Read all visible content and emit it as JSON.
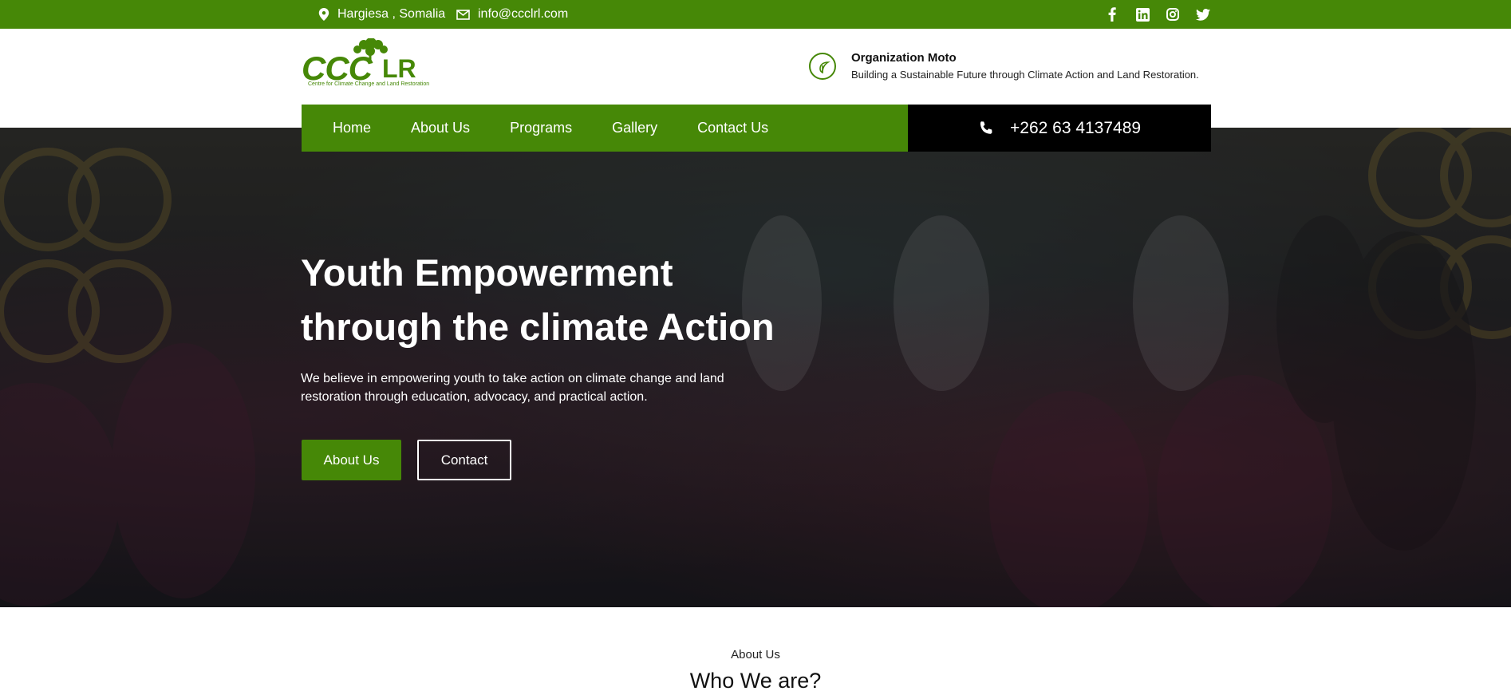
{
  "topbar": {
    "location": "Hargiesa , Somalia",
    "email": "info@ccclrl.com",
    "social": [
      "facebook-icon",
      "linkedin-icon",
      "instagram-icon",
      "twitter-icon"
    ]
  },
  "logo": {
    "main": "CCC",
    "suffix": "LR",
    "subtitle": "Centre for Climate Change and Land Restoration"
  },
  "motto": {
    "title": "Organization Moto",
    "text": "Building a Sustainable Future through Climate Action and Land Restoration."
  },
  "nav": {
    "items": [
      {
        "label": "Home"
      },
      {
        "label": "About Us"
      },
      {
        "label": "Programs"
      },
      {
        "label": "Gallery"
      },
      {
        "label": "Contact Us"
      }
    ],
    "phone": "+262 63 4137489"
  },
  "hero": {
    "title_line1": "Youth Empowerment",
    "title_line2": "through the climate Action",
    "text": "We believe in empowering youth to take action on climate change and land restoration through education, advocacy, and practical action.",
    "btn_about": "About Us",
    "btn_contact": "Contact"
  },
  "about": {
    "label": "About Us",
    "title": "Who We are?"
  },
  "colors": {
    "brand_green": "#468807",
    "phone_bg": "#000000"
  }
}
